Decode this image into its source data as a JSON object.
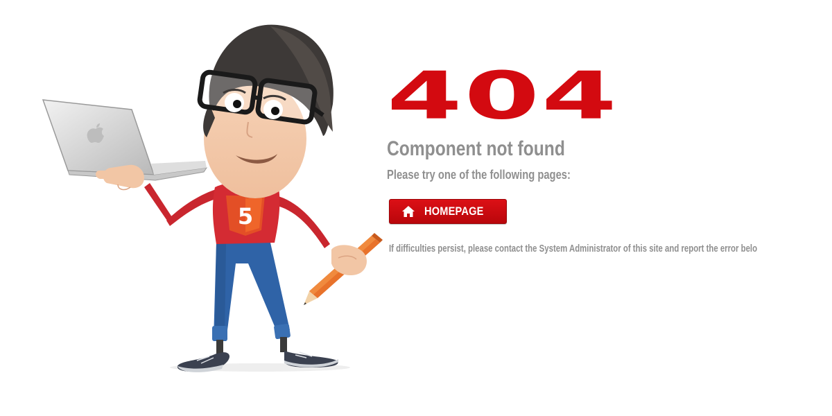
{
  "error": {
    "code": "404",
    "title": "Component not found",
    "subtitle": "Please try one of the following pages:",
    "footnote": "If difficulties persist, please contact the System Administrator of this site and report the error belo"
  },
  "actions": {
    "home_label": "HOMEPAGE",
    "home_icon": "home-icon"
  },
  "illustration": {
    "shirt_badge": "5",
    "laptop_logo": "apple-logo"
  },
  "colors": {
    "accent": "#d30a10",
    "text_muted": "#8f8f8f",
    "background": "#ffffff"
  }
}
